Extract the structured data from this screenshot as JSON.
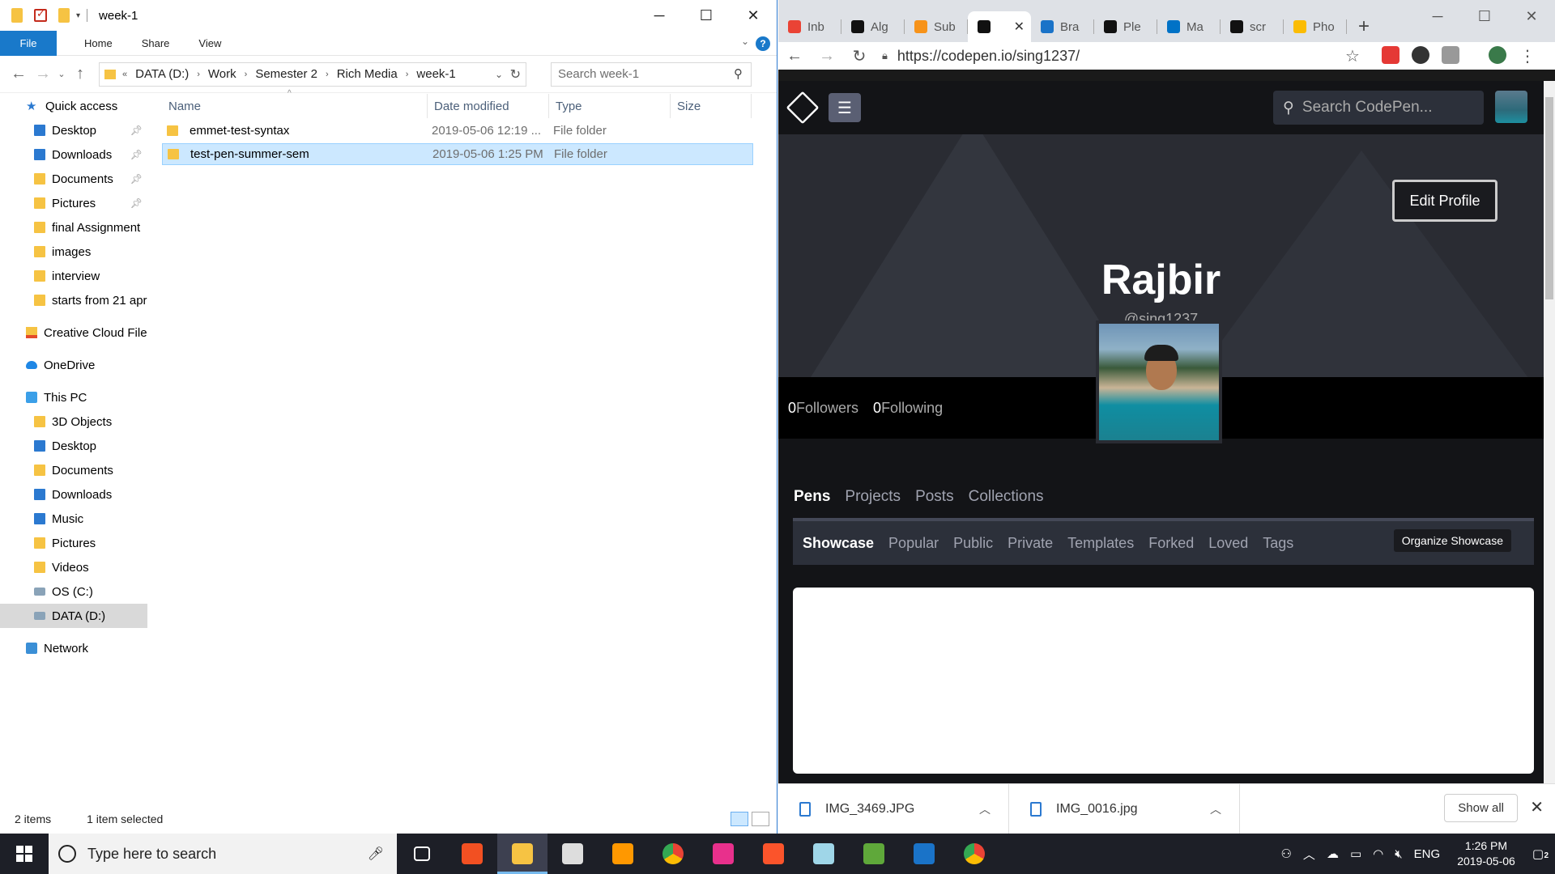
{
  "explorer": {
    "title": "week-1",
    "ribbon_tabs": [
      "File",
      "Home",
      "Share",
      "View"
    ],
    "breadcrumb": [
      "DATA (D:)",
      "Work",
      "Semester 2",
      "Rich Media",
      "week-1"
    ],
    "search_placeholder": "Search week-1",
    "nav": [
      {
        "label": "Quick access",
        "icon": "star-icon",
        "indent": 0
      },
      {
        "label": "Desktop",
        "icon": "desktop-icon",
        "indent": 1,
        "pinned": true
      },
      {
        "label": "Downloads",
        "icon": "download-icon",
        "indent": 1,
        "pinned": true
      },
      {
        "label": "Documents",
        "icon": "documents-icon",
        "indent": 1,
        "pinned": true
      },
      {
        "label": "Pictures",
        "icon": "pictures-icon",
        "indent": 1,
        "pinned": true
      },
      {
        "label": "final Assignment",
        "icon": "folder-icon",
        "indent": 1
      },
      {
        "label": "images",
        "icon": "folder-icon",
        "indent": 1
      },
      {
        "label": "interview",
        "icon": "folder-icon",
        "indent": 1
      },
      {
        "label": "starts from 21 apr",
        "icon": "folder-icon",
        "indent": 1
      },
      {
        "label": "Creative Cloud Files",
        "icon": "creative-cloud-icon",
        "indent": 0
      },
      {
        "label": "OneDrive",
        "icon": "cloud-icon",
        "indent": 0
      },
      {
        "label": "This PC",
        "icon": "pc-icon",
        "indent": 0
      },
      {
        "label": "3D Objects",
        "icon": "folder-icon",
        "indent": 1
      },
      {
        "label": "Desktop",
        "icon": "desktop-icon",
        "indent": 1
      },
      {
        "label": "Documents",
        "icon": "documents-icon",
        "indent": 1
      },
      {
        "label": "Downloads",
        "icon": "download-icon",
        "indent": 1
      },
      {
        "label": "Music",
        "icon": "music-icon",
        "indent": 1
      },
      {
        "label": "Pictures",
        "icon": "pictures-icon",
        "indent": 1
      },
      {
        "label": "Videos",
        "icon": "videos-icon",
        "indent": 1
      },
      {
        "label": "OS (C:)",
        "icon": "drive-icon",
        "indent": 1
      },
      {
        "label": "DATA (D:)",
        "icon": "drive-icon",
        "indent": 1,
        "selected": true
      },
      {
        "label": "Network",
        "icon": "network-icon",
        "indent": 0
      }
    ],
    "columns": [
      "Name",
      "Date modified",
      "Type",
      "Size"
    ],
    "files": [
      {
        "name": "emmet-test-syntax",
        "date": "2019-05-06 12:19 ...",
        "type": "File folder",
        "size": "",
        "selected": false
      },
      {
        "name": "test-pen-summer-sem",
        "date": "2019-05-06 1:25 PM",
        "type": "File folder",
        "size": "",
        "selected": true
      }
    ],
    "status_count": "2 items",
    "status_selected": "1 item selected"
  },
  "chrome": {
    "tabs": [
      {
        "label": "Inb",
        "icon": "gmail-icon",
        "color": "#ea4335"
      },
      {
        "label": "Alg",
        "icon": "algolia-icon",
        "color": "#111"
      },
      {
        "label": "Sub",
        "icon": "bitcoin-icon",
        "color": "#f7931a"
      },
      {
        "label": "",
        "icon": "codepen-icon",
        "color": "#111",
        "active": true
      },
      {
        "label": "Bra",
        "icon": "brackets-icon",
        "color": "#1a73c8"
      },
      {
        "label": "Ple",
        "icon": "github-icon",
        "color": "#111"
      },
      {
        "label": "Ma",
        "icon": "outlook-icon",
        "color": "#0072c6"
      },
      {
        "label": "scr",
        "icon": "github-icon",
        "color": "#111"
      },
      {
        "label": "Pho",
        "icon": "photos-icon",
        "color": "#fbbc04"
      }
    ],
    "url": "https://codepen.io/sing1237/",
    "downloads": [
      "IMG_3469.JPG",
      "IMG_0016.jpg"
    ],
    "show_all": "Show all"
  },
  "codepen": {
    "search_placeholder": "Search CodePen...",
    "edit_profile": "Edit Profile",
    "name": "Rajbir",
    "handle": "@sing1237",
    "followers_count": "0",
    "followers_label": "Followers",
    "following_count": "0",
    "following_label": "Following",
    "tabs": [
      "Pens",
      "Projects",
      "Posts",
      "Collections"
    ],
    "subtabs": [
      "Showcase",
      "Popular",
      "Public",
      "Private",
      "Templates",
      "Forked",
      "Loved",
      "Tags"
    ],
    "organize_button": "Organize Showcase"
  },
  "taskbar": {
    "search_placeholder": "Type here to search",
    "apps": [
      {
        "icon": "task-view-icon",
        "color": "#ffffff"
      },
      {
        "icon": "store-icon",
        "color": "#f25022"
      },
      {
        "icon": "file-explorer-icon",
        "color": "#f6c343",
        "active": true
      },
      {
        "icon": "camera-icon",
        "color": "#dddddd"
      },
      {
        "icon": "sublime-icon",
        "color": "#ff9800"
      },
      {
        "icon": "chrome-icon",
        "color": "#34a853"
      },
      {
        "icon": "webstorm-icon",
        "color": "#e8308c"
      },
      {
        "icon": "brave-icon",
        "color": "#fb542b"
      },
      {
        "icon": "notepad-icon",
        "color": "#9fd6e8"
      },
      {
        "icon": "photo-viewer-icon",
        "color": "#5fa83a"
      },
      {
        "icon": "brackets-icon",
        "color": "#1a73c8"
      },
      {
        "icon": "chrome-icon",
        "color": "#ea4335"
      }
    ],
    "lang": "ENG",
    "time": "1:26 PM",
    "date": "2019-05-06",
    "notifications": "2"
  }
}
